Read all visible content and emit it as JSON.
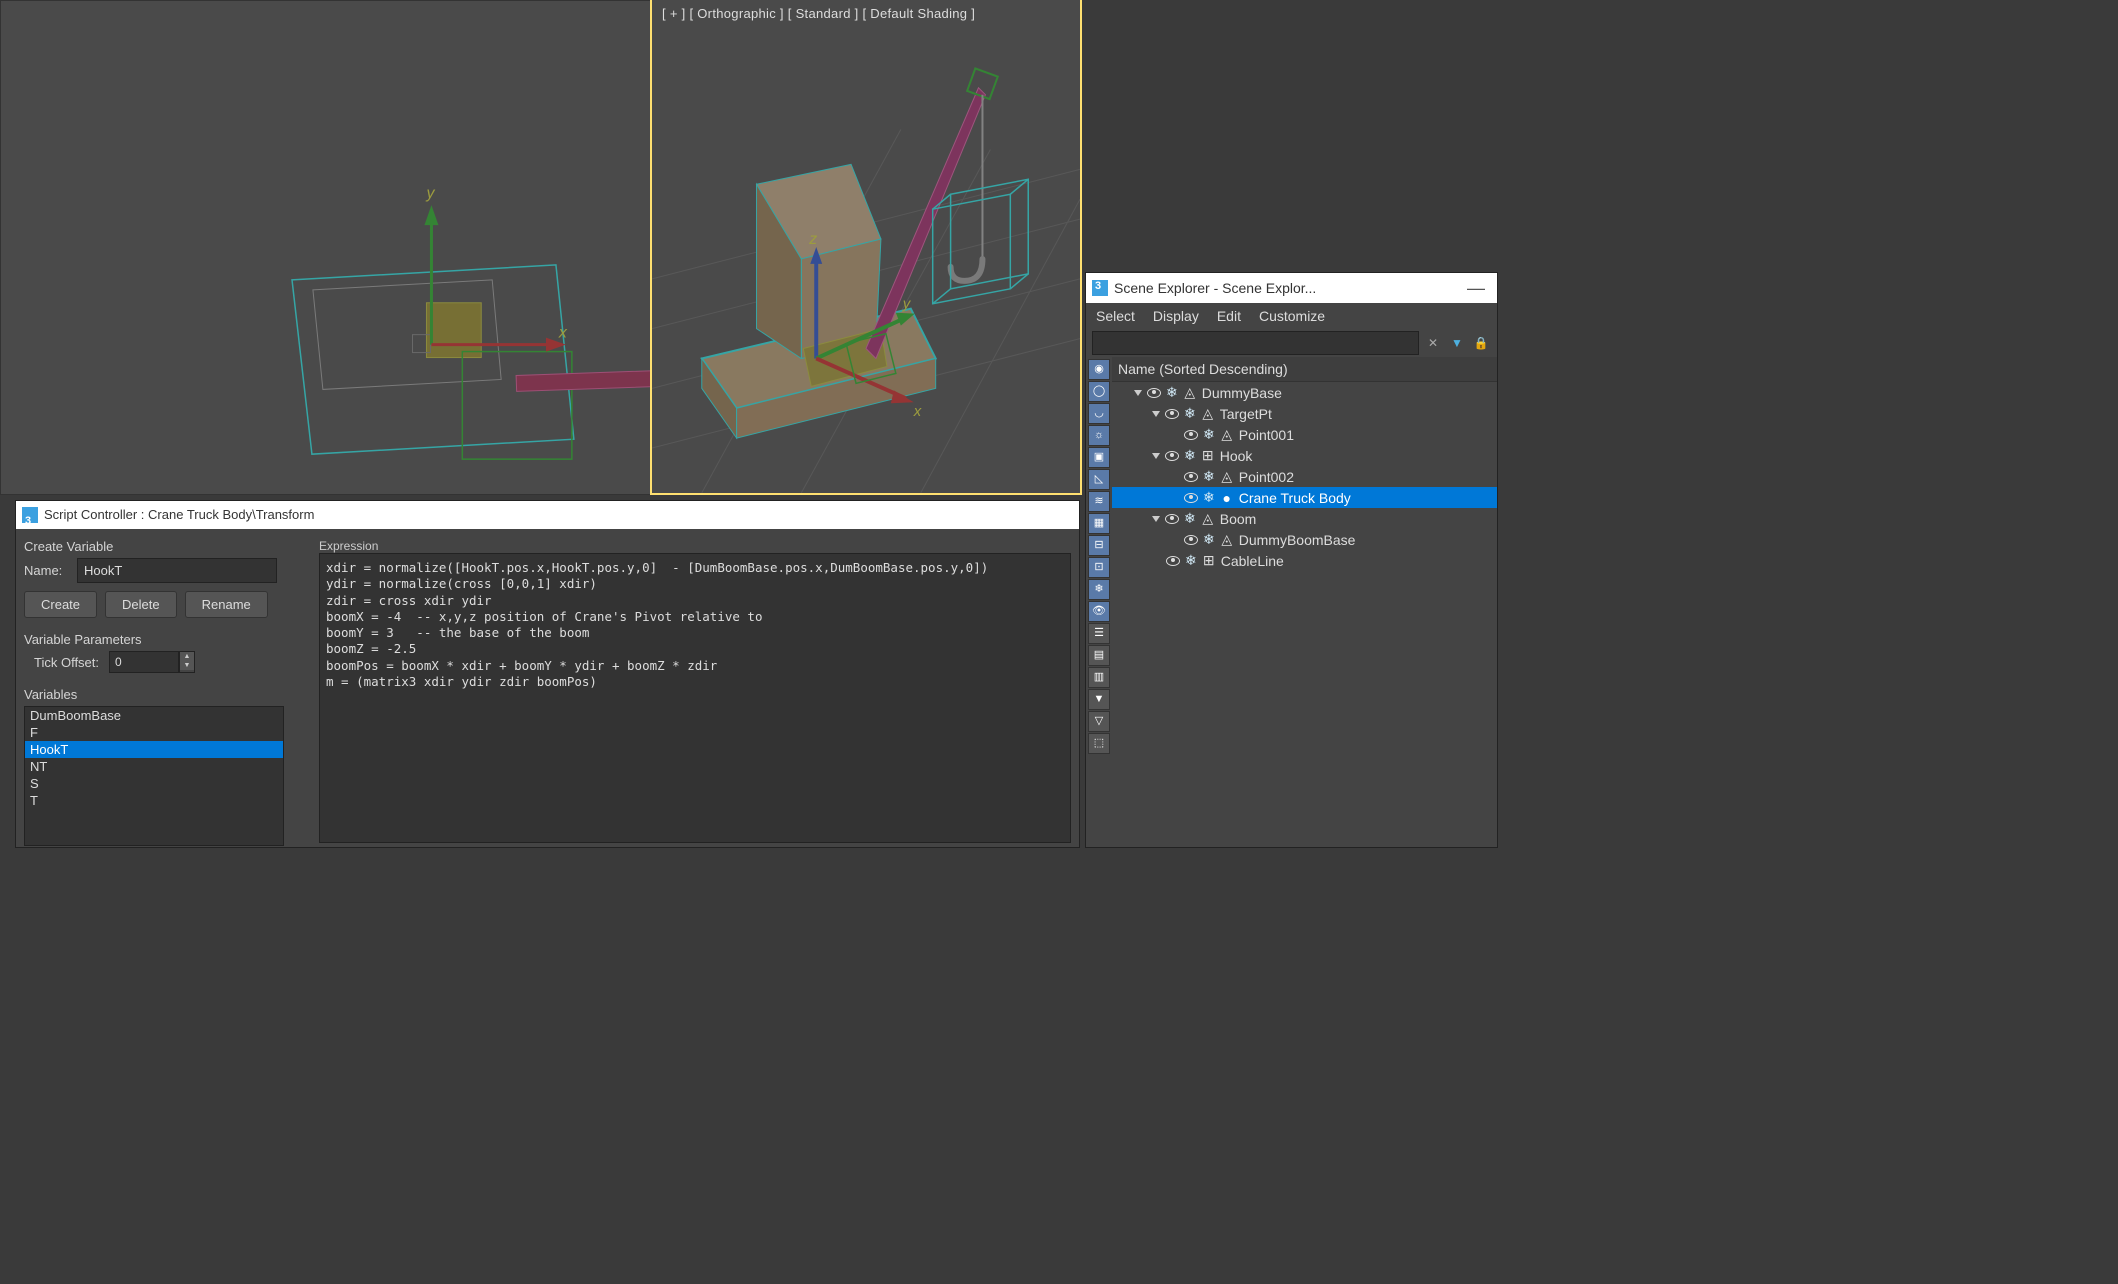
{
  "viewport_right_labels": "[ + ]   [ Orthographic ]   [ Standard ]   [ Default Shading ]",
  "script_controller": {
    "title": "Script Controller : Crane Truck Body\\Transform",
    "create_variable_label": "Create Variable",
    "name_label": "Name:",
    "name_value": "HookT",
    "btn_create": "Create",
    "btn_delete": "Delete",
    "btn_rename": "Rename",
    "var_params_label": "Variable Parameters",
    "tick_offset_label": "Tick Offset:",
    "tick_offset_value": "0",
    "variables_label": "Variables",
    "variables": [
      "DumBoomBase",
      "F",
      "HookT",
      "NT",
      "S",
      "T"
    ],
    "selected_variable": "HookT",
    "expression_label": "Expression",
    "expression": "xdir = normalize([HookT.pos.x,HookT.pos.y,0]  - [DumBoomBase.pos.x,DumBoomBase.pos.y,0])\nydir = normalize(cross [0,0,1] xdir)\nzdir = cross xdir ydir\nboomX = -4  -- x,y,z position of Crane's Pivot relative to\nboomY = 3   -- the base of the boom\nboomZ = -2.5\nboomPos = boomX * xdir + boomY * ydir + boomZ * zdir\nm = (matrix3 xdir ydir zdir boomPos)"
  },
  "scene_explorer": {
    "title": "Scene Explorer - Scene Explor...",
    "menu": {
      "select": "Select",
      "display": "Display",
      "edit": "Edit",
      "customize": "Customize"
    },
    "header": "Name (Sorted Descending)",
    "selected_node": "Crane Truck Body",
    "tree": [
      {
        "name": "DummyBase",
        "icon": "dummy",
        "indent": 1,
        "expand": true
      },
      {
        "name": "TargetPt",
        "icon": "dummy",
        "indent": 2,
        "expand": true
      },
      {
        "name": "Point001",
        "icon": "dummy",
        "indent": 3
      },
      {
        "name": "Hook",
        "icon": "group",
        "indent": 2,
        "expand": true
      },
      {
        "name": "Point002",
        "icon": "dummy",
        "indent": 3
      },
      {
        "name": "Crane Truck Body",
        "icon": "geom",
        "indent": 3,
        "selected": true
      },
      {
        "name": "Boom",
        "icon": "dummy",
        "indent": 2,
        "expand": true
      },
      {
        "name": "DummyBoomBase",
        "icon": "dummy",
        "indent": 3
      },
      {
        "name": "CableLine",
        "icon": "group",
        "indent": 2
      }
    ]
  }
}
